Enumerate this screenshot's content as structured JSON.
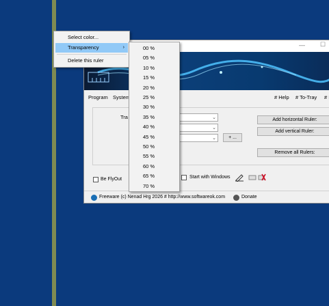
{
  "window": {
    "menu_program": "Program",
    "menu_system": "System",
    "help": "# Help",
    "to_tray": "# To-Tray",
    "trailing": "# I",
    "panel_label": "Tra",
    "add_horizontal": "Add horizontal Ruler:",
    "add_vertical": "Add vertical Ruler:",
    "remove_all": "Remove all Rulers:",
    "plus_button": "+ ...",
    "be_flyout": "Be FlyOut",
    "start_with_windows": "Start with Windows",
    "footer_text": "Freeware (c) Nenad Hrg 2026 # http://www.softwareok.com",
    "donate": "Donate",
    "minimize_glyph": "—",
    "maximize_glyph": "☐"
  },
  "context_menu": {
    "items": [
      "Select color...",
      "Transparency",
      "Delete this ruler"
    ],
    "submenu_arrow": "›"
  },
  "transparency_submenu": {
    "items": [
      "00 %",
      "05 %",
      "10 %",
      "15 %",
      "20 %",
      "25 %",
      "30 %",
      "35 %",
      "40 %",
      "45 %",
      "50 %",
      "55 %",
      "60 %",
      "65 %",
      "70 %"
    ]
  },
  "colors": {
    "desktop": "#0b3a7d",
    "ruler": "#7f8b52",
    "menu_highlight": "#91c9f7"
  }
}
